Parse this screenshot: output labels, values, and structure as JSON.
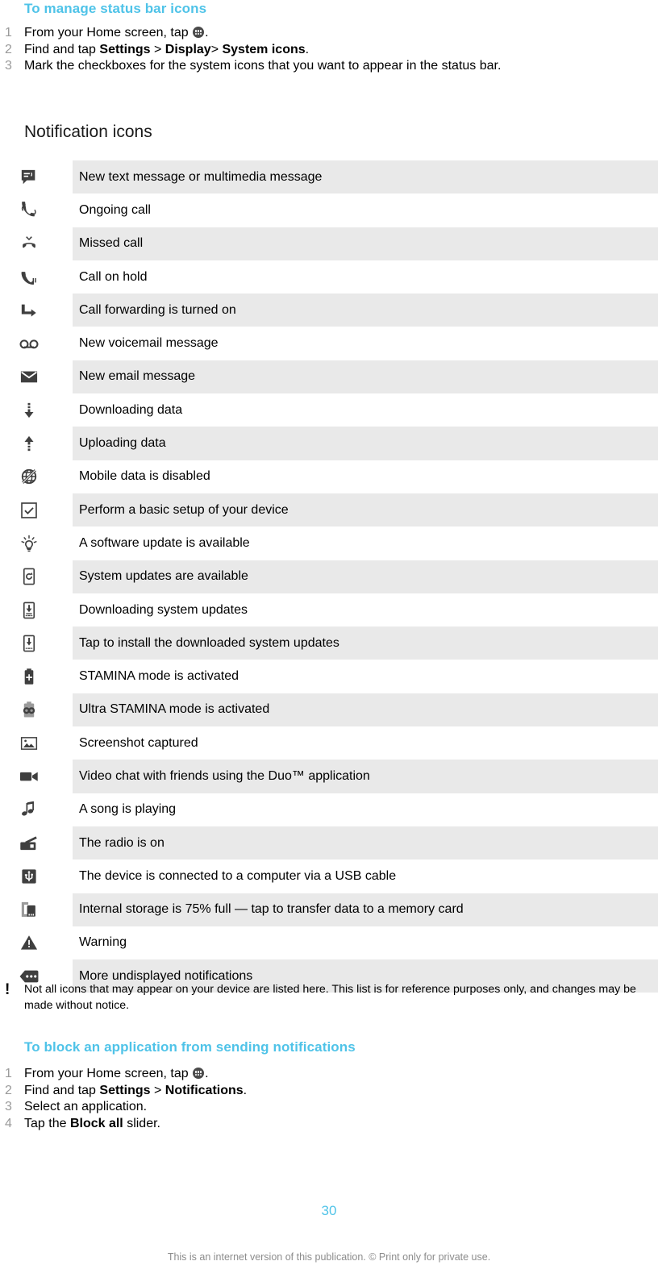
{
  "colors": {
    "accent": "#4fc3e8",
    "row_shade": "#e9e9e9",
    "step_number": "#9a9a9a",
    "icon_dark": "#3f3f3f",
    "footer_text": "#8c8c8c"
  },
  "procedure_1": {
    "heading": "To manage status bar icons",
    "steps": [
      {
        "number": "1",
        "parts": [
          {
            "type": "text",
            "value": "From your Home screen, tap "
          },
          {
            "type": "icon",
            "value": "app-drawer-icon"
          },
          {
            "type": "text",
            "value": "."
          }
        ]
      },
      {
        "number": "2",
        "parts": [
          {
            "type": "text",
            "value": "Find and tap "
          },
          {
            "type": "bold",
            "value": "Settings"
          },
          {
            "type": "text",
            "value": " > "
          },
          {
            "type": "bold",
            "value": "Display"
          },
          {
            "type": "text",
            "value": "> "
          },
          {
            "type": "bold",
            "value": "System icons"
          },
          {
            "type": "text",
            "value": "."
          }
        ]
      },
      {
        "number": "3",
        "parts": [
          {
            "type": "text",
            "value": "Mark the checkboxes for the system icons that you want to appear in the status bar."
          }
        ]
      }
    ]
  },
  "section": {
    "heading": "Notification icons"
  },
  "icon_table": {
    "rows": [
      {
        "icon": "message-bubble-icon",
        "description": "New text message or multimedia message"
      },
      {
        "icon": "ongoing-call-icon",
        "description": "Ongoing call"
      },
      {
        "icon": "missed-call-icon",
        "description": "Missed call"
      },
      {
        "icon": "call-on-hold-icon",
        "description": "Call on hold"
      },
      {
        "icon": "call-forwarding-icon",
        "description": "Call forwarding is turned on"
      },
      {
        "icon": "voicemail-icon",
        "description": "New voicemail message"
      },
      {
        "icon": "email-envelope-icon",
        "description": "New email message"
      },
      {
        "icon": "download-arrow-icon",
        "description": "Downloading data"
      },
      {
        "icon": "upload-arrow-icon",
        "description": "Uploading data"
      },
      {
        "icon": "mobile-data-disabled-icon",
        "description": "Mobile data is disabled"
      },
      {
        "icon": "checkbox-setup-icon",
        "description": "Perform a basic setup of your device"
      },
      {
        "icon": "lightbulb-update-icon",
        "description": "A software update is available"
      },
      {
        "icon": "system-update-available-icon",
        "description": "System updates are available"
      },
      {
        "icon": "system-update-downloading-icon",
        "description": "Downloading system updates"
      },
      {
        "icon": "system-update-install-icon",
        "description": "Tap to install the downloaded system updates"
      },
      {
        "icon": "stamina-battery-icon",
        "description": "STAMINA mode is activated"
      },
      {
        "icon": "ultra-stamina-battery-icon",
        "description": "Ultra STAMINA mode is activated"
      },
      {
        "icon": "screenshot-image-icon",
        "description": "Screenshot captured"
      },
      {
        "icon": "video-camera-icon",
        "description": "Video chat with friends using the Duo™ application"
      },
      {
        "icon": "music-note-icon",
        "description": "A song is playing"
      },
      {
        "icon": "radio-icon",
        "description": "The radio is on"
      },
      {
        "icon": "usb-icon",
        "description": "The device is connected to a computer via a USB cable"
      },
      {
        "icon": "internal-storage-icon",
        "description": "Internal storage is 75% full — tap to transfer data to a memory card"
      },
      {
        "icon": "warning-triangle-icon",
        "description": "Warning"
      },
      {
        "icon": "more-notifications-icon",
        "description": "More undisplayed notifications"
      }
    ]
  },
  "note": {
    "marker": "!",
    "text": "Not all icons that may appear on your device are listed here. This list is for reference purposes only, and changes may be made without notice."
  },
  "procedure_2": {
    "heading": "To block an application from sending notifications",
    "steps": [
      {
        "number": "1",
        "parts": [
          {
            "type": "text",
            "value": "From your Home screen, tap "
          },
          {
            "type": "icon",
            "value": "app-drawer-icon"
          },
          {
            "type": "text",
            "value": "."
          }
        ]
      },
      {
        "number": "2",
        "parts": [
          {
            "type": "text",
            "value": "Find and tap "
          },
          {
            "type": "bold",
            "value": "Settings"
          },
          {
            "type": "text",
            "value": " > "
          },
          {
            "type": "bold",
            "value": "Notifications"
          },
          {
            "type": "text",
            "value": "."
          }
        ]
      },
      {
        "number": "3",
        "parts": [
          {
            "type": "text",
            "value": "Select an application."
          }
        ]
      },
      {
        "number": "4",
        "parts": [
          {
            "type": "text",
            "value": "Tap the "
          },
          {
            "type": "bold",
            "value": "Block all"
          },
          {
            "type": "text",
            "value": " slider."
          }
        ]
      }
    ]
  },
  "footer": {
    "page_number": "30",
    "disclaimer": "This is an internet version of this publication. © Print only for private use."
  }
}
